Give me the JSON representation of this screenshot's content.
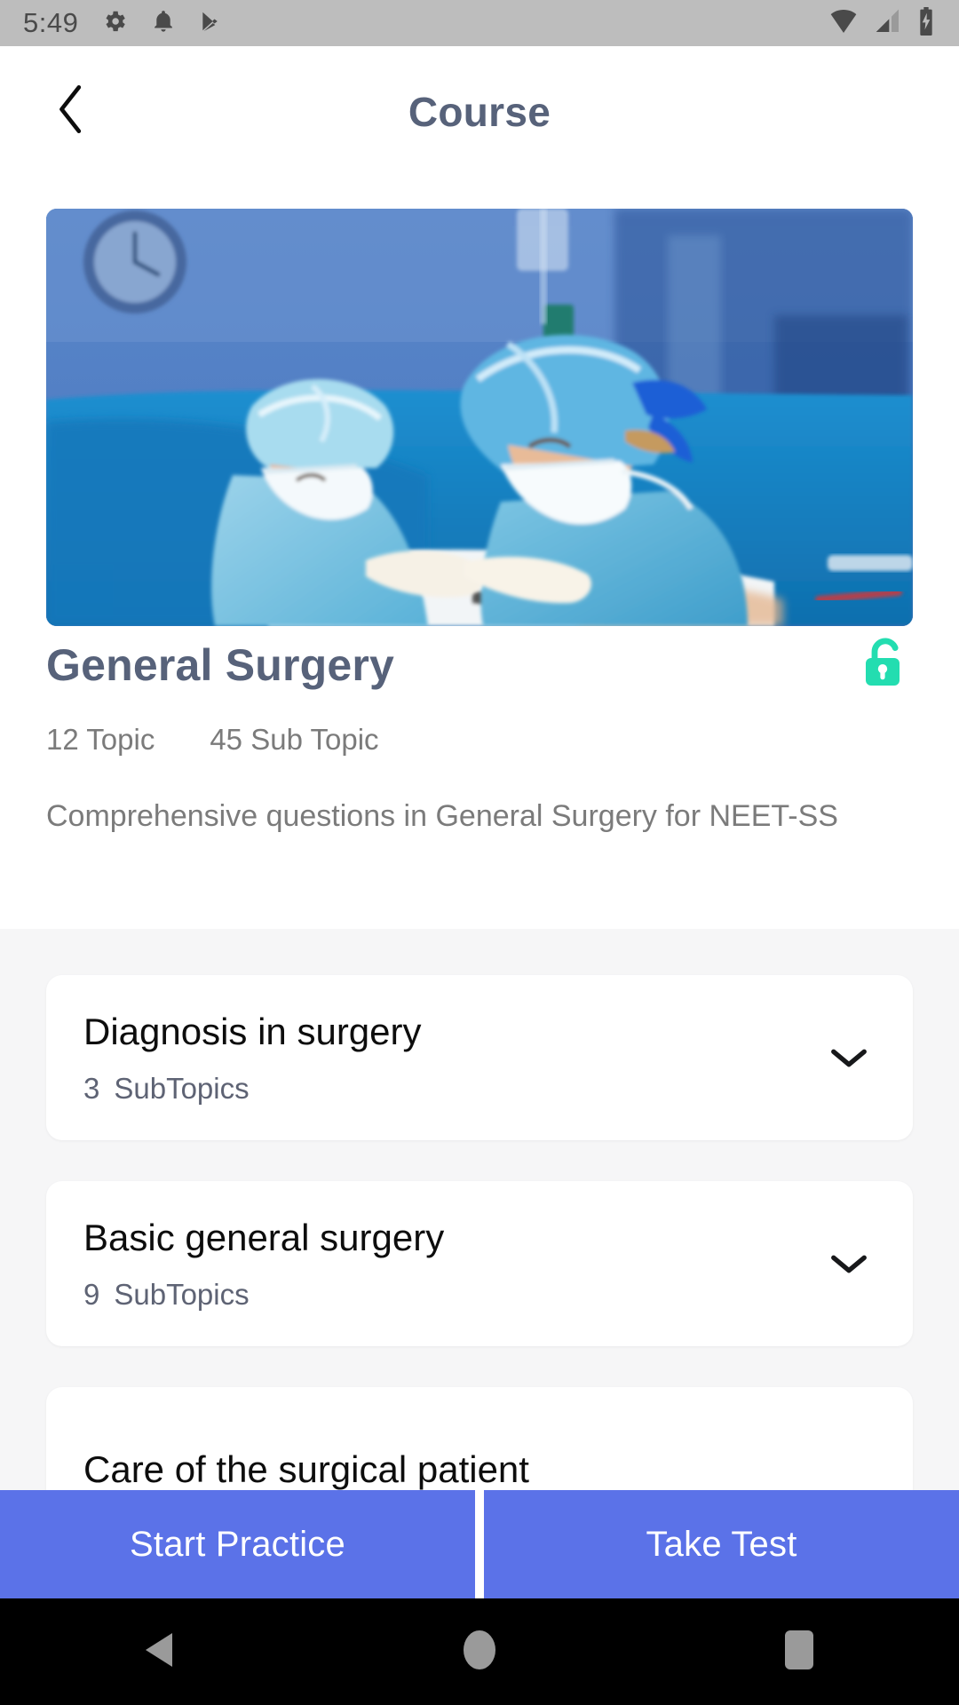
{
  "statusbar": {
    "time": "5:49",
    "left_icons": [
      "gear-icon",
      "bell-icon",
      "play-store-icon"
    ],
    "right_icons": [
      "wifi-icon",
      "cellular-signal-icon",
      "battery-charging-icon"
    ],
    "background": "#bdbdbd"
  },
  "appbar": {
    "back_icon": "chevron-left-icon",
    "title": "Course",
    "title_color": "#57627a"
  },
  "hero": {
    "alt": "Two surgeons in blue scrubs and masks operating in an operating room with a wall clock"
  },
  "course": {
    "title": "General Surgery",
    "lock_icon": "unlock-icon",
    "lock_color": "#23ddb0",
    "topic_count": "12 Topic",
    "subtopic_count": "45 Sub Topic",
    "description": "Comprehensive questions in General Surgery for NEET-SS"
  },
  "topics": [
    {
      "name": "Diagnosis in surgery",
      "count": "3",
      "count_label": "SubTopics",
      "chevron": "chevron-down-icon"
    },
    {
      "name": "Basic general surgery",
      "count": "9",
      "count_label": "SubTopics",
      "chevron": "chevron-down-icon"
    },
    {
      "name": "Care of  the surgical patient",
      "count": "",
      "count_label": "",
      "chevron": "chevron-down-icon"
    }
  ],
  "actions": {
    "primary_label": "Start Practice",
    "secondary_label": "Take Test",
    "color": "#5b72e8"
  },
  "navbar": {
    "back_icon": "nav-back-triangle-icon",
    "home_icon": "nav-home-circle-icon",
    "recents_icon": "nav-recents-square-icon"
  }
}
